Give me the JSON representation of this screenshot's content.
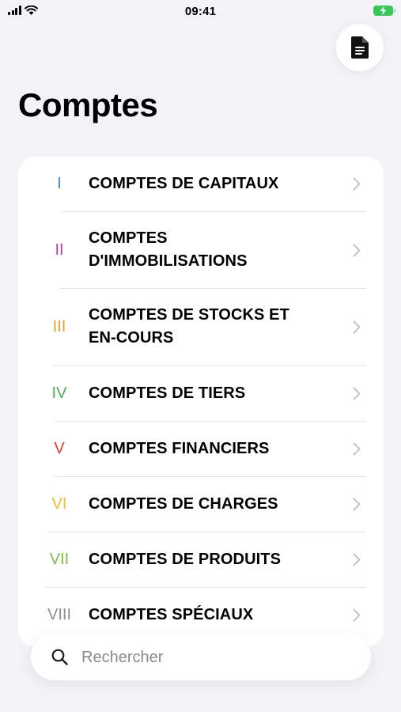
{
  "status_bar": {
    "time": "09:41"
  },
  "header": {
    "title": "Comptes"
  },
  "accounts": [
    {
      "numeral": "I",
      "label": "COMPTES DE CAPITAUX",
      "color": "#3b82f6"
    },
    {
      "numeral": "II",
      "label": "COMPTES D'IMMOBILISATIONS",
      "color": "#c0409a"
    },
    {
      "numeral": "III",
      "label": "COMPTES DE STOCKS ET EN-COURS",
      "color": "#f39c2b"
    },
    {
      "numeral": "IV",
      "label": "COMPTES DE TIERS",
      "color": "#4caf50"
    },
    {
      "numeral": "V",
      "label": "COMPTES FINANCIERS",
      "color": "#e53935"
    },
    {
      "numeral": "VI",
      "label": "COMPTES DE CHARGES",
      "color": "#f2c12e"
    },
    {
      "numeral": "VII",
      "label": "COMPTES DE PRODUITS",
      "color": "#7cc142"
    },
    {
      "numeral": "VIII",
      "label": "COMPTES SPÉCIAUX",
      "color": "#8e8e93"
    }
  ],
  "search": {
    "placeholder": "Rechercher",
    "value": ""
  },
  "icons": {
    "document_button": "document-icon",
    "search": "search-icon",
    "row_chevron": "chevron-right-icon"
  }
}
